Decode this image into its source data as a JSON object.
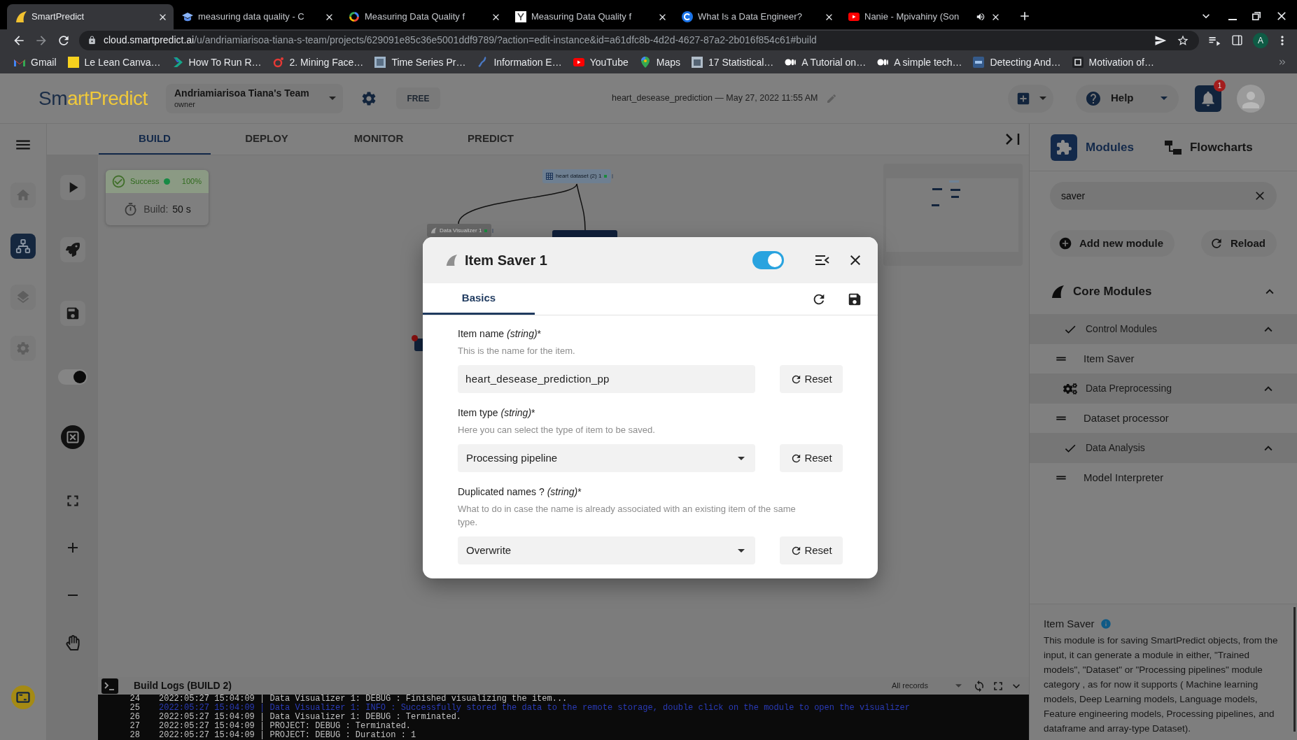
{
  "browser": {
    "tabs": [
      {
        "title": "SmartPredict",
        "selected": true,
        "audio": false
      },
      {
        "title": "measuring data quality - C",
        "selected": false,
        "audio": false
      },
      {
        "title": "Measuring Data Quality f",
        "selected": false,
        "audio": false
      },
      {
        "title": "Measuring Data Quality f",
        "selected": false,
        "audio": false
      },
      {
        "title": "What Is a Data Engineer?",
        "selected": false,
        "audio": false
      },
      {
        "title": "Nanie - Mpivahiny (Son",
        "selected": false,
        "audio": true
      }
    ],
    "url": {
      "host": "cloud.smartpredict.ai",
      "path": "/u/andriamiarisoa-tiana-s-team/projects/629091e85c36e5001ddf9789/?action=edit-instance&id=a61dfc8b-4d2d-4627-87a2-2b016f854c61#build"
    },
    "profile": "A",
    "bookmarks": [
      "Gmail",
      "Le Lean Canva…",
      "How To Run R…",
      "2. Mining Face…",
      "Time Series Pr…",
      "Information E…",
      "YouTube",
      "Maps",
      "17 Statistical…",
      "A Tutorial on…",
      "A simple tech…",
      "Detecting And…",
      "Motivation of…"
    ]
  },
  "header": {
    "logo": [
      "Sm",
      "artPredict"
    ],
    "team": {
      "name": "Andriamiarisoa Tiana's Team",
      "role": "owner"
    },
    "plan": "FREE",
    "project": "heart_desease_prediction — May 27, 2022 11:55 AM",
    "help": "Help",
    "notifications": "1"
  },
  "nav": [
    {
      "selected": false
    },
    {
      "selected": true
    },
    {
      "selected": false
    },
    {
      "selected": false
    }
  ],
  "tabs": [
    {
      "label": "BUILD",
      "selected": true
    },
    {
      "label": "DEPLOY",
      "selected": false
    },
    {
      "label": "MONITOR",
      "selected": false
    },
    {
      "label": "PREDICT",
      "selected": false
    }
  ],
  "tools": {
    "switch_on": true
  },
  "build": {
    "status": "Success",
    "percent": "100%",
    "label": "Build:",
    "duration": "50 s"
  },
  "canvas": {
    "nodes": [
      {
        "label": "heart dataset (2) 1",
        "kind": "dataset"
      },
      {
        "label": "Data Visualizer 1",
        "kind": "module"
      }
    ]
  },
  "modal": {
    "title": "Item Saver 1",
    "enabled": true,
    "tabs": [
      {
        "label": "Basics",
        "selected": true
      }
    ],
    "fields": [
      {
        "label": "Item name",
        "type": "(string)",
        "suffix": "*",
        "hint": "This is the name for the item.",
        "kind": "text",
        "value": "heart_desease_prediction_pp",
        "reset": "Reset"
      },
      {
        "label": "Item type",
        "type": "(string)",
        "suffix": "*",
        "hint": "Here you can select the type of item to be saved.",
        "kind": "select",
        "value": "Processing pipeline",
        "reset": "Reset"
      },
      {
        "label": "Duplicated names ?",
        "type": "(string)",
        "suffix": "*",
        "hint": "What to do in case the name is already associated with an existing item of the same type.",
        "kind": "select",
        "value": "Overwrite",
        "reset": "Reset"
      }
    ]
  },
  "panel": {
    "tabs": [
      {
        "label": "Modules",
        "selected": true
      },
      {
        "label": "Flowcharts",
        "selected": false
      }
    ],
    "search": {
      "value": "saver"
    },
    "actions": [
      {
        "label": "Add new module",
        "kind": "add"
      },
      {
        "label": "Reload",
        "kind": "reload"
      }
    ],
    "tree": [
      {
        "label": "Core Modules",
        "expanded": true,
        "children": [
          {
            "label": "Control Modules",
            "kind": "check",
            "expanded": true,
            "children": [
              {
                "label": "Item Saver"
              }
            ]
          },
          {
            "label": "Data Preprocessing",
            "kind": "gears",
            "expanded": true,
            "children": [
              {
                "label": "Dataset processor"
              }
            ]
          },
          {
            "label": "Data Analysis",
            "kind": "check",
            "expanded": true,
            "children": [
              {
                "label": "Model Interpreter"
              }
            ]
          }
        ]
      }
    ],
    "description": {
      "title": "Item Saver",
      "text": "This module is for saving SmartPredict objects, from the input, it can generate a module in either, \"Trained models\", \"Dataset\" or \"Processing pipelines\" module category , as for now it supports ( Machine learning models, Deep Learning models, Language models, Feature engineering models, Processing pipelines, and dataframe and array-type Dataset)."
    }
  },
  "logs": {
    "title": "Build Logs (BUILD 2)",
    "filter": "All records",
    "lines": [
      {
        "number": "24",
        "kind": "debug",
        "text": "2022:05:27 15:04:09 | Data Visualizer 1: DEBUG : Finished visualizing the item..."
      },
      {
        "number": "25",
        "kind": "info",
        "text": "2022:05:27 15:04:09 | Data Visualizer 1: INFO : Successfully stored the data to the remote storage, double click on the module to open the visualizer"
      },
      {
        "number": "26",
        "kind": "debug",
        "text": "2022:05:27 15:04:09 | Data Visualizer 1: DEBUG : Terminated."
      },
      {
        "number": "27",
        "kind": "debug",
        "text": "2022:05:27 15:04:09 | PROJECT: DEBUG : Terminated."
      },
      {
        "number": "28",
        "kind": "debug",
        "text": "2022:05:27 15:04:09 | PROJECT: DEBUG : Duration : 1"
      }
    ]
  }
}
